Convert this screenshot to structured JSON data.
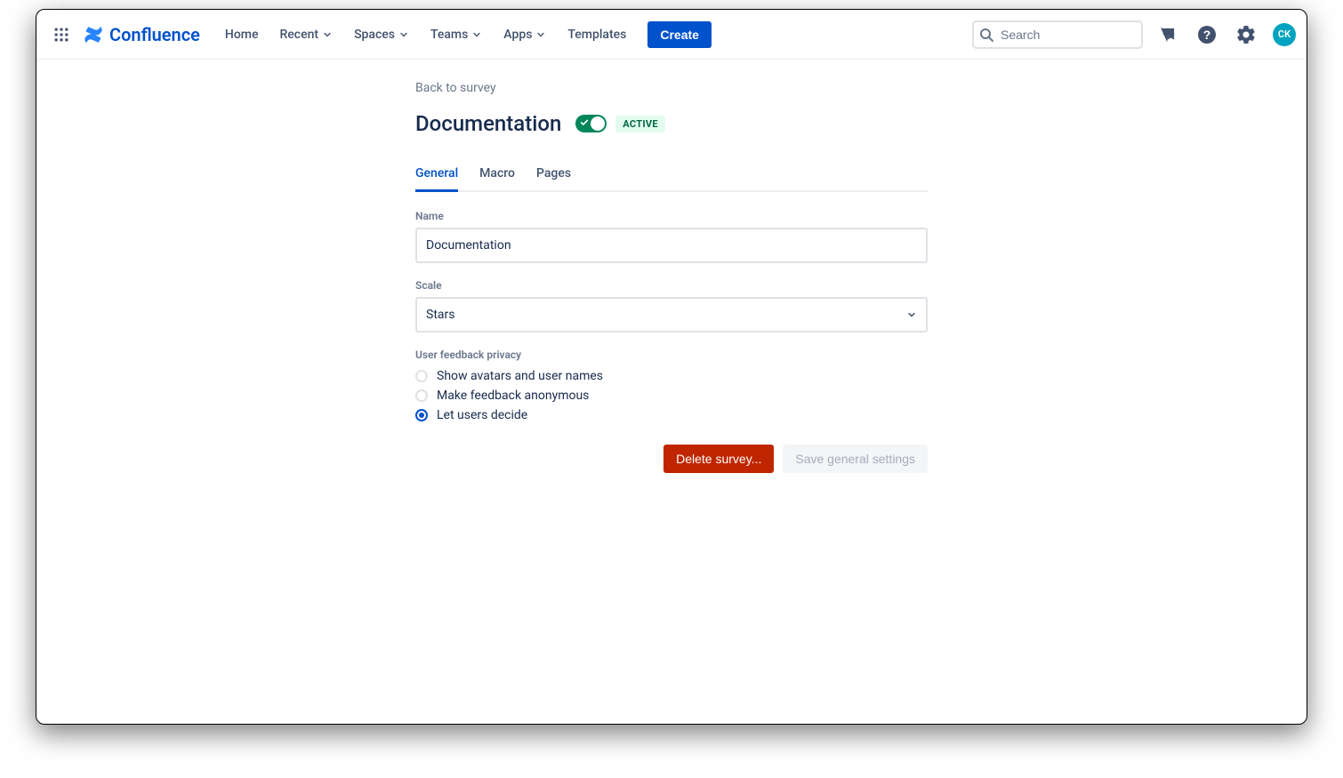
{
  "brand": "Confluence",
  "nav": {
    "home": "Home",
    "recent": "Recent",
    "spaces": "Spaces",
    "teams": "Teams",
    "apps": "Apps",
    "templates": "Templates",
    "create": "Create"
  },
  "search": {
    "placeholder": "Search"
  },
  "avatar": {
    "initials": "CK"
  },
  "backlink": "Back to survey",
  "page": {
    "title": "Documentation",
    "status": "ACTIVE"
  },
  "tabs": {
    "general": "General",
    "macro": "Macro",
    "pages": "Pages"
  },
  "form": {
    "name_label": "Name",
    "name_value": "Documentation",
    "scale_label": "Scale",
    "scale_value": "Stars",
    "privacy_label": "User feedback privacy",
    "privacy_options": {
      "show": "Show avatars and user names",
      "anon": "Make feedback anonymous",
      "decide": "Let users decide"
    }
  },
  "actions": {
    "delete": "Delete survey...",
    "save": "Save general settings"
  }
}
